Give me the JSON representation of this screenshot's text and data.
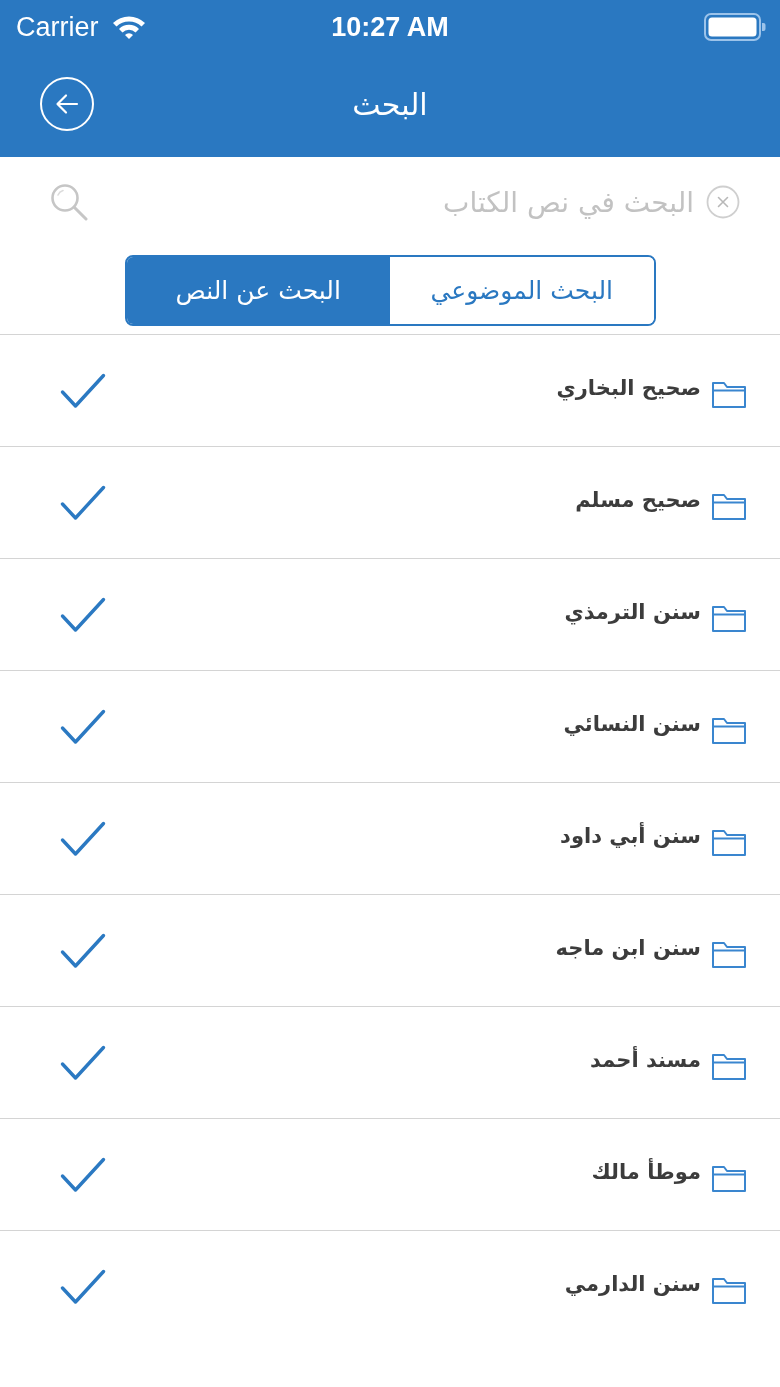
{
  "status_bar": {
    "carrier": "Carrier",
    "time": "10:27 AM"
  },
  "nav_bar": {
    "title": "البحث"
  },
  "search": {
    "placeholder": "البحث في نص الكتاب"
  },
  "segments": [
    {
      "label": "البحث الموضوعي",
      "selected": false
    },
    {
      "label": "البحث عن النص",
      "selected": true
    }
  ],
  "books": [
    {
      "title": "صحيح البخاري",
      "checked": true
    },
    {
      "title": "صحيح مسلم",
      "checked": true
    },
    {
      "title": "سنن الترمذي",
      "checked": true
    },
    {
      "title": "سنن النسائي",
      "checked": true
    },
    {
      "title": "سنن أبي داود",
      "checked": true
    },
    {
      "title": "سنن ابن ماجه",
      "checked": true
    },
    {
      "title": "مسند أحمد",
      "checked": true
    },
    {
      "title": "موطأ مالك",
      "checked": true
    },
    {
      "title": "سنن الدارمي",
      "checked": true
    }
  ]
}
